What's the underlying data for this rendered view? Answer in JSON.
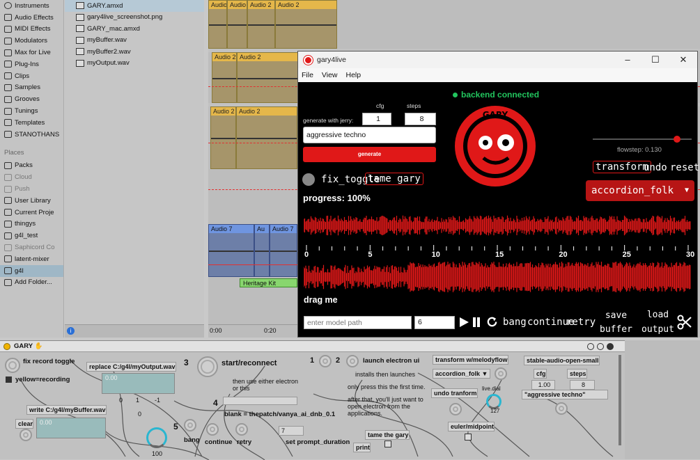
{
  "categories": {
    "items": [
      {
        "label": "Instruments",
        "icon": "clock-icon"
      },
      {
        "label": "Audio Effects",
        "icon": "audio-effects-icon"
      },
      {
        "label": "MIDI Effects",
        "icon": "midi-effects-icon"
      },
      {
        "label": "Modulators",
        "icon": "modulators-icon"
      },
      {
        "label": "Max for Live",
        "icon": "max-for-live-icon"
      },
      {
        "label": "Plug-Ins",
        "icon": "plug-ins-icon"
      },
      {
        "label": "Clips",
        "icon": "clips-icon"
      },
      {
        "label": "Samples",
        "icon": "samples-icon"
      },
      {
        "label": "Grooves",
        "icon": "grooves-icon"
      },
      {
        "label": "Tunings",
        "icon": "tunings-icon"
      },
      {
        "label": "Templates",
        "icon": "templates-icon"
      },
      {
        "label": "STANOTHANS",
        "icon": "user-folder-icon"
      }
    ],
    "places_heading": "Places",
    "places": [
      {
        "label": "Packs",
        "dim": false
      },
      {
        "label": "Cloud",
        "dim": true
      },
      {
        "label": "Push",
        "dim": true
      },
      {
        "label": "User Library",
        "dim": false
      },
      {
        "label": "Current Proje",
        "dim": false
      },
      {
        "label": "thingys",
        "dim": false
      },
      {
        "label": "g4l_test",
        "dim": false
      },
      {
        "label": "Saphicord Co",
        "dim": true
      },
      {
        "label": "latent-mixer",
        "dim": false
      },
      {
        "label": "g4l",
        "dim": false,
        "selected": true
      },
      {
        "label": "Add Folder...",
        "dim": false
      }
    ]
  },
  "files": [
    {
      "name": "GARY.amxd",
      "selected": true
    },
    {
      "name": "gary4live_screenshot.png"
    },
    {
      "name": "GARY_mac.amxd"
    },
    {
      "name": "myBuffer.wav"
    },
    {
      "name": "myBuffer2.wav"
    },
    {
      "name": "myOutput.wav"
    }
  ],
  "arrangement": {
    "clip_labels": [
      "Audio",
      "Audio",
      "Audio 2",
      "Audio 2",
      "Audio 2",
      "Audio 2",
      "Audio 2",
      "Audio 2",
      "Audio 7",
      "Au",
      "Audio 7"
    ],
    "heritage_kit": "Heritage Kit",
    "ruler": [
      "0:00",
      "0:20"
    ]
  },
  "gary": {
    "window_title": "gary4live",
    "menu": [
      "File",
      "View",
      "Help"
    ],
    "status": "backend connected",
    "cfg_label": "cfg",
    "steps_label": "steps",
    "generate_label": "generate with jerry:",
    "cfg_value": "1",
    "steps_value": "8",
    "prompt_value": "aggressive techno",
    "generate_button": "generate",
    "fix_toggle": "fix_toggle",
    "tame_gary": "tame gary",
    "progress": "progress: 100%",
    "logo_text": "GARY",
    "flowstep": "flowstep: 0.130",
    "flowstep_fraction": 0.85,
    "transform": "transform",
    "undo": "undo",
    "reset": "reset",
    "model_select": "accordion_folk",
    "ruler_labels": [
      "0",
      "5",
      "10",
      "15",
      "20",
      "25",
      "30"
    ],
    "drag_me": "drag me",
    "model_path_placeholder": "enter model path",
    "model_path_number": "6",
    "bang": "bang",
    "continue": "continue",
    "retry": "retry",
    "save_buffer": [
      "save",
      "buffer"
    ],
    "load_output": [
      "load",
      "output"
    ],
    "accent": "#e01818",
    "status_color": "#22c55e"
  },
  "max": {
    "title": "GARY",
    "fix_record_toggle": "fix record toggle",
    "yellow_recording": "yellow=recording",
    "replace": "replace C:/g4l/myOutput.wav",
    "write": "write C:/g4l/myBuffer.wav",
    "clear": "clear",
    "num_000": "0.00",
    "num_row": [
      "0",
      "1",
      "-1"
    ],
    "num_0": "0",
    "num_100": "100",
    "three": "3",
    "start_reconnect": "start/reconnect",
    "then_use": [
      "then use either electron",
      "or this"
    ],
    "four": "4",
    "five": "5",
    "blank": "blank = thepatch/vanya_ai_dnb_0.1",
    "bang": "bang",
    "continue": "continue",
    "retry": "retry",
    "seven": "7",
    "set_prompt_duration": "set prompt_duration",
    "print": "print",
    "one": "1",
    "two": "2",
    "launch": "launch electron ui",
    "installs": "installs then launches",
    "only_press": "only press this the first time.",
    "after_that": [
      "after that, you'll just want to",
      "open electron from the",
      "applications."
    ],
    "tame_the_gary": "tame the gary",
    "transform_melodyflow": "transform w/melodyflow",
    "accordion_folk": "accordion_folk",
    "undo_tranform": "undo tranform",
    "live_dial": "live.dial",
    "dial_value": "127",
    "euler_midpoint": "euler/midpoint",
    "stable_audio": "stable-audio-open-small",
    "cfg": "cfg",
    "steps": "steps",
    "cfg_value": "1.00",
    "steps_value": "8",
    "prompt": "\"aggressive techno\""
  }
}
